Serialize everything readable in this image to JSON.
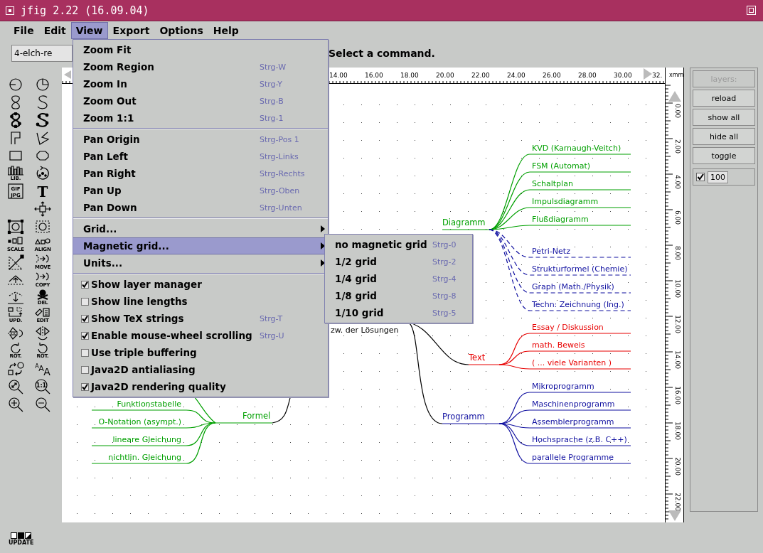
{
  "window": {
    "title": "jfig 2.22 (16.09.04)"
  },
  "menu_bar": [
    {
      "label": "File",
      "selected": false
    },
    {
      "label": "Edit",
      "selected": false
    },
    {
      "label": "View",
      "selected": true
    },
    {
      "label": "Export",
      "selected": false
    },
    {
      "label": "Options",
      "selected": false
    },
    {
      "label": "Help",
      "selected": false
    }
  ],
  "command_bar": {
    "filename": "4-elch-re",
    "status": "Select a command."
  },
  "tools": [
    {
      "kind": "circle"
    },
    {
      "kind": "pie"
    },
    {
      "kind": "figure-eight"
    },
    {
      "kind": "s-curve"
    },
    {
      "kind": "closed-figure-eight"
    },
    {
      "kind": "closed-s-curve"
    },
    {
      "kind": "polyline"
    },
    {
      "kind": "polygon"
    },
    {
      "kind": "rectangle"
    },
    {
      "kind": "octagon"
    },
    {
      "kind": "library",
      "caption": "LIB."
    },
    {
      "kind": "circular-arrow"
    },
    {
      "kind": "image",
      "glyphs": [
        "GIF",
        "JPG"
      ]
    },
    {
      "kind": "text",
      "glyphs": [
        "T"
      ]
    },
    {
      "kind": "move-arrows"
    },
    {
      "kind": "framed-circle"
    },
    {
      "kind": "dashed-framed-circle"
    },
    {
      "kind": "scale",
      "caption": "SCALE"
    },
    {
      "kind": "align",
      "caption": "ALIGN"
    },
    {
      "kind": "dashed-triangle"
    },
    {
      "kind": "move",
      "caption": "MOVE"
    },
    {
      "kind": "add-point"
    },
    {
      "kind": "copy",
      "caption": "COPY"
    },
    {
      "kind": "remove-point"
    },
    {
      "kind": "delete",
      "caption": "DEL"
    },
    {
      "kind": "refresh-objects",
      "caption": "UPD."
    },
    {
      "kind": "edit",
      "caption": "EDIT"
    },
    {
      "kind": "flip-vertical"
    },
    {
      "kind": "flip-horizontal"
    },
    {
      "kind": "rotate-right",
      "caption": "ROT."
    },
    {
      "kind": "rotate-left",
      "caption": "ROT."
    },
    {
      "kind": "convert"
    },
    {
      "kind": "text-size",
      "glyphs": [
        "A",
        "A",
        "A"
      ]
    },
    {
      "kind": "zoom-fit"
    },
    {
      "kind": "zoom-actual",
      "glyphs": [
        "1:1"
      ]
    },
    {
      "kind": "zoom-in"
    },
    {
      "kind": "zoom-out"
    }
  ],
  "top_ruler": {
    "unit": "xmm",
    "labels": [
      "14.00",
      "16.00",
      "18.00",
      "20.00",
      "22.00",
      "24.00",
      "26.00",
      "28.00",
      "30.00",
      "32."
    ]
  },
  "side_ruler": {
    "labels": [
      "0.00",
      "2.00",
      "4.00",
      "6.00",
      "8.00",
      "10.00",
      "12.00",
      "14.00",
      "16.00",
      "18.00",
      "20.00",
      "22.00"
    ]
  },
  "diagram": {
    "root_fragment": "zw. der Lösungen",
    "branches": [
      {
        "label": "Diagramm",
        "color": "#00a000",
        "kind": "solid",
        "children": [
          "KVD (Karnaugh-Veitch)",
          "FSM (Automat)",
          "Schaltplan",
          "Impulsdiagramm",
          "Flußdiagramm"
        ]
      },
      {
        "color": "#1010a0",
        "kind": "dashed",
        "children": [
          "Petri-Netz",
          "Strukturformel (Chemie)",
          "Graph (Math./Physik)",
          "Techn: Zeichnung (Ing.)"
        ]
      },
      {
        "label": "Text",
        "color": "#e80000",
        "kind": "solid",
        "children": [
          "Essay / Diskussion",
          "math. Beweis",
          "( ... viele Varianten )"
        ]
      },
      {
        "label": "Formel",
        "color": "#00a000",
        "kind": "solid",
        "children": [
          "Funktionstabelle",
          "O-Notation (asympt.)",
          "lineare Gleichung",
          "nichtlin. Gleichung"
        ]
      },
      {
        "label": "Programm",
        "color": "#1010a0",
        "kind": "solid",
        "children": [
          "Mikroprogramm",
          "Maschinenprogramm",
          "Assemblerprogramm",
          "Hochsprache (z.B. C++)",
          "parallele Programme"
        ]
      }
    ]
  },
  "layers": {
    "buttons": [
      {
        "label": "layers:",
        "disabled": true
      },
      {
        "label": "reload",
        "disabled": false
      },
      {
        "label": "show all",
        "disabled": false
      },
      {
        "label": "hide all",
        "disabled": false
      },
      {
        "label": "toggle",
        "disabled": false
      }
    ],
    "depth": {
      "checked": true,
      "value": "100"
    }
  },
  "update_button": {
    "caption": "UPDATE"
  },
  "view_menu": {
    "items": [
      {
        "kind": "command",
        "label": "Zoom Fit",
        "selected": false
      },
      {
        "kind": "command",
        "label": "Zoom Region",
        "shortcut": "Strg-W",
        "selected": false
      },
      {
        "kind": "command",
        "label": "Zoom In",
        "shortcut": "Strg-Y",
        "selected": false
      },
      {
        "kind": "command",
        "label": "Zoom Out",
        "shortcut": "Strg-B",
        "selected": false
      },
      {
        "kind": "command",
        "label": "Zoom 1:1",
        "shortcut": "Strg-1",
        "selected": false
      },
      {
        "kind": "separator"
      },
      {
        "kind": "command",
        "label": "Pan Origin",
        "shortcut": "Strg-Pos 1",
        "selected": false
      },
      {
        "kind": "command",
        "label": "Pan Left",
        "shortcut": "Strg-Links",
        "selected": false
      },
      {
        "kind": "command",
        "label": "Pan Right",
        "shortcut": "Strg-Rechts",
        "selected": false
      },
      {
        "kind": "command",
        "label": "Pan Up",
        "shortcut": "Strg-Oben",
        "selected": false
      },
      {
        "kind": "command",
        "label": "Pan Down",
        "shortcut": "Strg-Unten",
        "selected": false
      },
      {
        "kind": "separator"
      },
      {
        "kind": "submenu",
        "label": "Grid...",
        "selected": false
      },
      {
        "kind": "submenu",
        "label": "Magnetic grid...",
        "selected": true
      },
      {
        "kind": "submenu",
        "label": "Units...",
        "selected": false
      },
      {
        "kind": "separator"
      },
      {
        "kind": "check",
        "label": "Show layer manager",
        "checked": true,
        "selected": false
      },
      {
        "kind": "check",
        "label": "Show line lengths",
        "checked": false,
        "selected": false
      },
      {
        "kind": "check",
        "label": "Show TeX strings",
        "shortcut": "Strg-T",
        "checked": true,
        "selected": false
      },
      {
        "kind": "check",
        "label": "Enable mouse-wheel scrolling",
        "shortcut": "Strg-U",
        "checked": true,
        "selected": false
      },
      {
        "kind": "check",
        "label": "Use triple buffering",
        "checked": false,
        "selected": false
      },
      {
        "kind": "check",
        "label": "Java2D antialiasing",
        "checked": false,
        "selected": false
      },
      {
        "kind": "check",
        "label": "Java2D rendering quality",
        "checked": true,
        "selected": false
      }
    ]
  },
  "magnetic_grid_menu": {
    "items": [
      {
        "kind": "command",
        "label": "no magnetic grid",
        "shortcut": "Strg-0",
        "selected": false
      },
      {
        "kind": "command",
        "label": "1/2 grid",
        "shortcut": "Strg-2",
        "selected": false
      },
      {
        "kind": "command",
        "label": "1/4 grid",
        "shortcut": "Strg-4",
        "selected": false
      },
      {
        "kind": "command",
        "label": "1/8 grid",
        "shortcut": "Strg-8",
        "selected": false
      },
      {
        "kind": "command",
        "label": "1/10 grid",
        "shortcut": "Strg-5",
        "selected": false
      }
    ]
  }
}
